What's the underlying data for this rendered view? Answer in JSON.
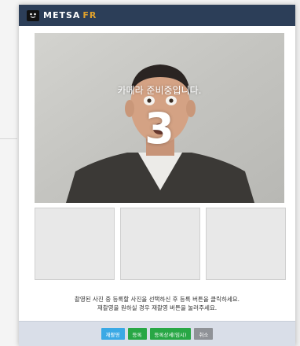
{
  "app": {
    "logo_main": "METSA",
    "logo_accent": "FR",
    "logo_icon": "mascot-face-icon"
  },
  "camera": {
    "status_message": "카메라 준비중입니다.",
    "countdown": "3"
  },
  "help": {
    "line1": "촬영된 사진 중 등록할 사진을 선택하신 후 등록 버튼을 클릭하세요.",
    "line2": "재촬영을 원하실 경우 재촬영 버튼을 눌러주세요."
  },
  "buttons": {
    "retake": "재촬영",
    "register": "등록",
    "register_temp": "등록상세(임시)",
    "cancel": "취소"
  },
  "colors": {
    "titlebar": "#2c3e58",
    "retake": "#3aa9e5",
    "register": "#28a745",
    "cancel": "#8f9297"
  }
}
